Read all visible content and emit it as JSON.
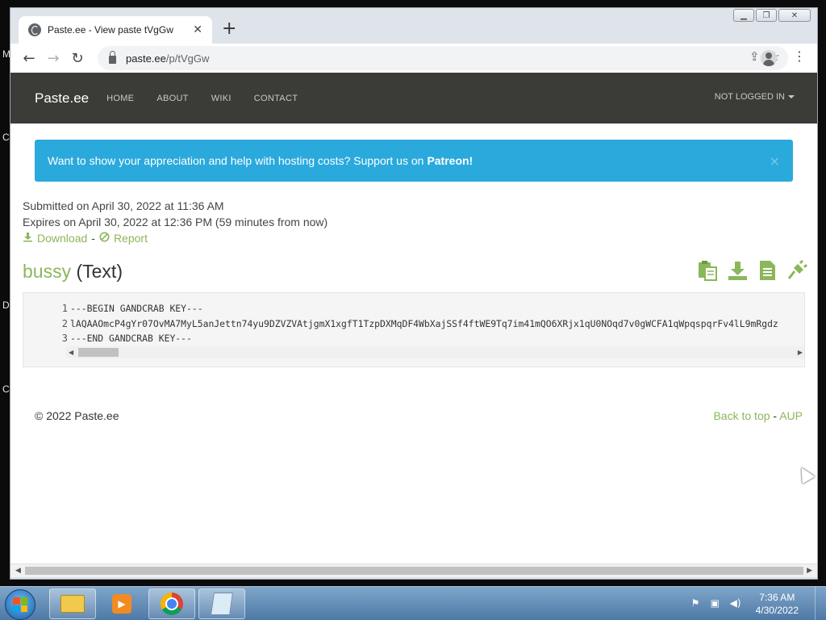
{
  "desktop": {
    "edge_letters": [
      "M",
      "C",
      "D",
      "C"
    ]
  },
  "browser": {
    "tab_title": "Paste.ee - View paste tVgGw",
    "url_host": "paste.ee",
    "url_path": "/p/tVgGw"
  },
  "site": {
    "brand": "Paste.ee",
    "nav": [
      "HOME",
      "ABOUT",
      "WIKI",
      "CONTACT"
    ],
    "login": "NOT LOGGED IN",
    "alert_text": "Want to show your appreciation and help with hosting costs? Support us on",
    "alert_link": "Patreon!",
    "alert_close": "×"
  },
  "paste": {
    "submitted": "Submitted on April 30, 2022 at 11:36 AM",
    "expires": "Expires on April 30, 2022 at 12:36 PM (59 minutes from now)",
    "download_label": "Download",
    "separator": "-",
    "report_label": "Report",
    "name": "bussy",
    "type": "(Text)",
    "line_numbers": [
      "1",
      "2",
      "3"
    ],
    "lines": [
      "---BEGIN GANDCRAB KEY---",
      "lAQAAOmcP4gYr07OvMA7MyL5anJettn74yu9DZVZVAtjgmX1xgfT1TzpDXMqDF4WbXajSSf4ftWE9Tq7im41mQO6XRjx1qU0NOqd7v0gWCFA1qWpqspqrFv4lL9mRgdz",
      "---END GANDCRAB KEY---"
    ]
  },
  "footer": {
    "copyright": "© 2022 Paste.ee",
    "back_to_top": "Back to top",
    "dash": "-",
    "aup": "AUP"
  },
  "taskbar": {
    "time": "7:36 AM",
    "date": "4/30/2022"
  },
  "colors": {
    "accent_green": "#8cb65a",
    "navbar": "#3b3b37",
    "alert_blue": "#2aa9dd"
  },
  "icons": [
    "clipboard-icon",
    "download-icon",
    "document-icon",
    "plug-icon",
    "lock-icon",
    "star-icon",
    "share-icon"
  ]
}
